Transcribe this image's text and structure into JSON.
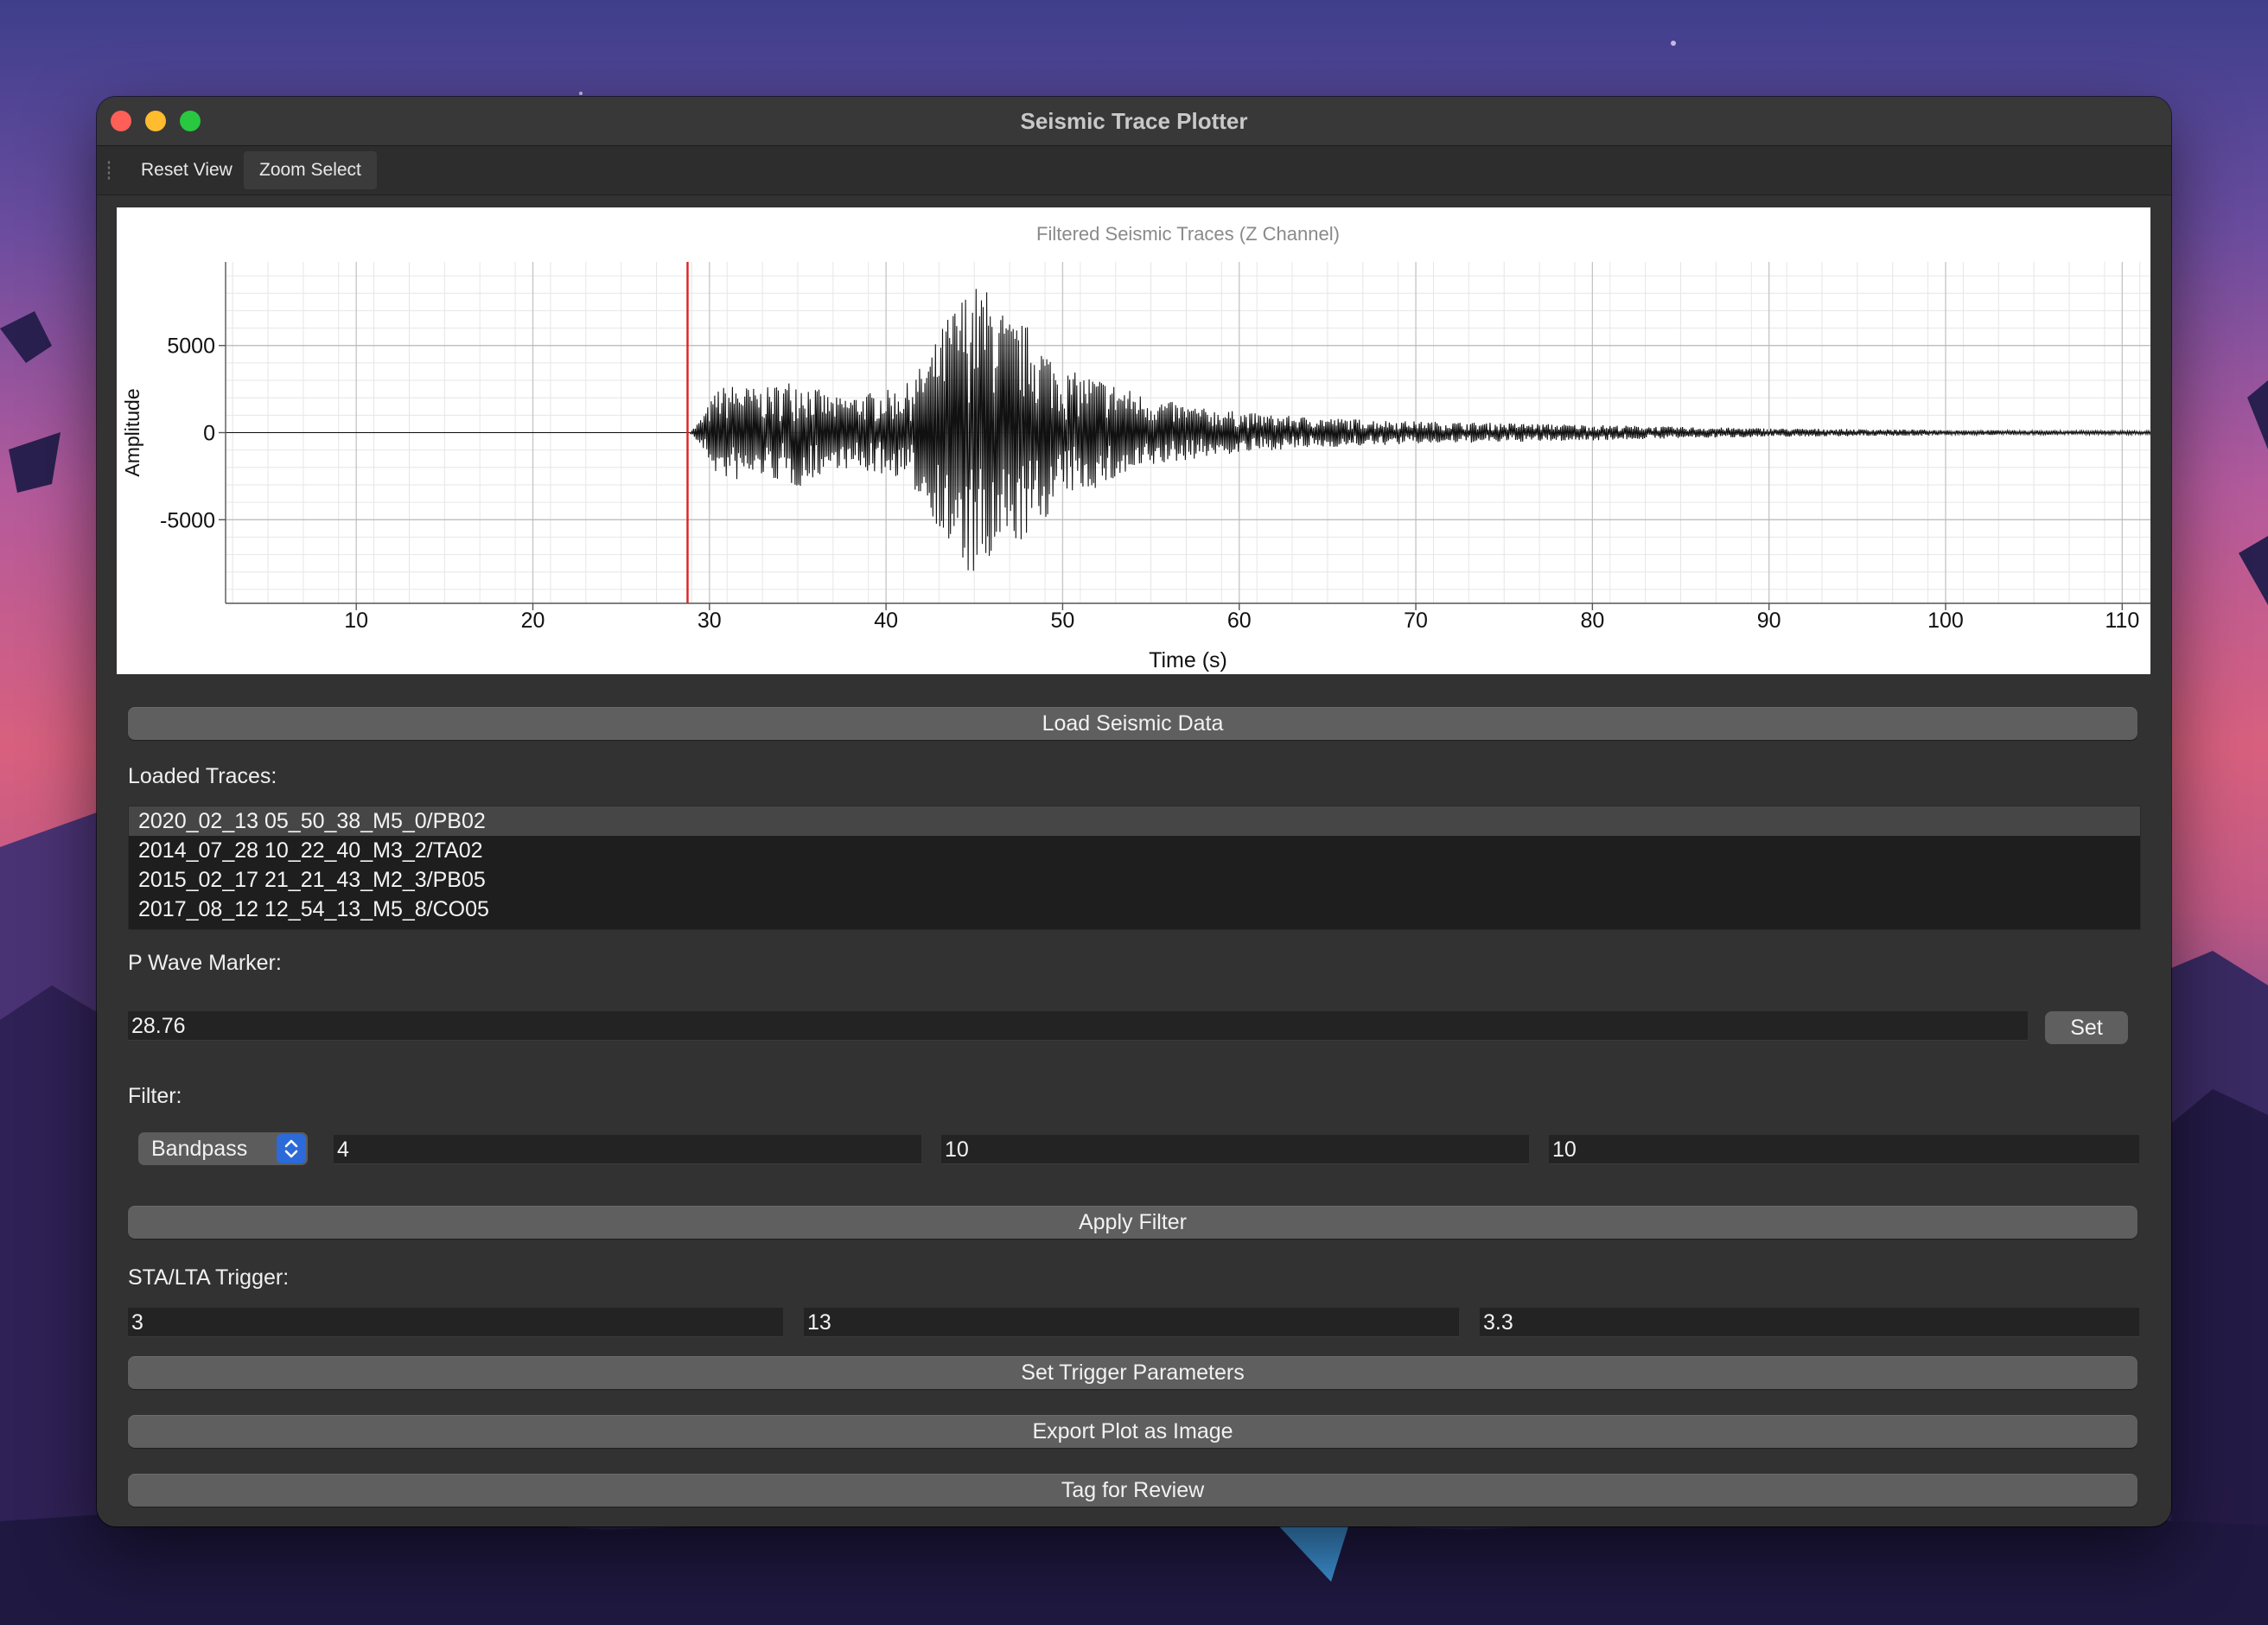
{
  "window": {
    "title": "Seismic Trace Plotter"
  },
  "toolbar": {
    "reset_view": "Reset View",
    "zoom_select": "Zoom Select"
  },
  "chart_data": {
    "type": "line",
    "title": "Filtered Seismic Traces (Z Channel)",
    "xlabel": "Time (s)",
    "ylabel": "Amplitude",
    "xlim": [
      2.6,
      111.6
    ],
    "ylim": [
      -9800,
      9800
    ],
    "x_ticks": [
      10,
      20,
      30,
      40,
      50,
      60,
      70,
      80,
      90,
      100,
      110
    ],
    "y_ticks": [
      5000,
      0,
      -5000
    ],
    "x_tick_labels": [
      "10",
      "20",
      "30",
      "40",
      "50",
      "60",
      "70",
      "80",
      "90",
      "100",
      "110"
    ],
    "y_tick_labels": [
      "5000",
      "0",
      "-5000"
    ],
    "grid": true,
    "p_wave_marker_x": 28.76,
    "series": [
      {
        "color": "#000000",
        "envelope": {
          "x": [
            28.9,
            29.5,
            30.5,
            31.5,
            33,
            35,
            37,
            39,
            41,
            42.5,
            43.5,
            44.5,
            45.3,
            46,
            47,
            48,
            49,
            50,
            52,
            55,
            58,
            62,
            66,
            70,
            75,
            80,
            85,
            90,
            95,
            100,
            105,
            111.6
          ],
          "amplitude": [
            0,
            800,
            2600,
            2800,
            2500,
            3200,
            2000,
            2300,
            2600,
            4500,
            6800,
            8200,
            8600,
            8000,
            6500,
            6200,
            5000,
            3600,
            3200,
            2000,
            1400,
            1000,
            800,
            650,
            550,
            450,
            330,
            250,
            200,
            160,
            130,
            110
          ]
        }
      }
    ]
  },
  "controls": {
    "load_button": "Load Seismic Data",
    "loaded_traces_label": "Loaded Traces:",
    "traces": [
      "2020_02_13 05_50_38_M5_0/PB02",
      "2014_07_28 10_22_40_M3_2/TA02",
      "2015_02_17 21_21_43_M2_3/PB05",
      "2017_08_12 12_54_13_M5_8/CO05"
    ],
    "selected_trace_index": 0,
    "p_wave_label": "P Wave Marker:",
    "p_wave_value": "28.76",
    "set_button": "Set",
    "filter_label": "Filter:",
    "filter_type": "Bandpass",
    "filter_param_1": "4",
    "filter_param_2": "10",
    "filter_param_3": "10",
    "apply_filter_button": "Apply Filter",
    "sta_lta_label": "STA/LTA Trigger:",
    "sta_value": "3",
    "lta_value": "13",
    "threshold_value": "3.3",
    "set_trigger_button": "Set Trigger Parameters",
    "export_button": "Export Plot as Image",
    "tag_button": "Tag for Review"
  },
  "colors": {
    "window_bg": "#323232",
    "button_bg": "#5f5f5f",
    "marker_red": "#e02020",
    "combo_accent": "#2b6ad8"
  }
}
